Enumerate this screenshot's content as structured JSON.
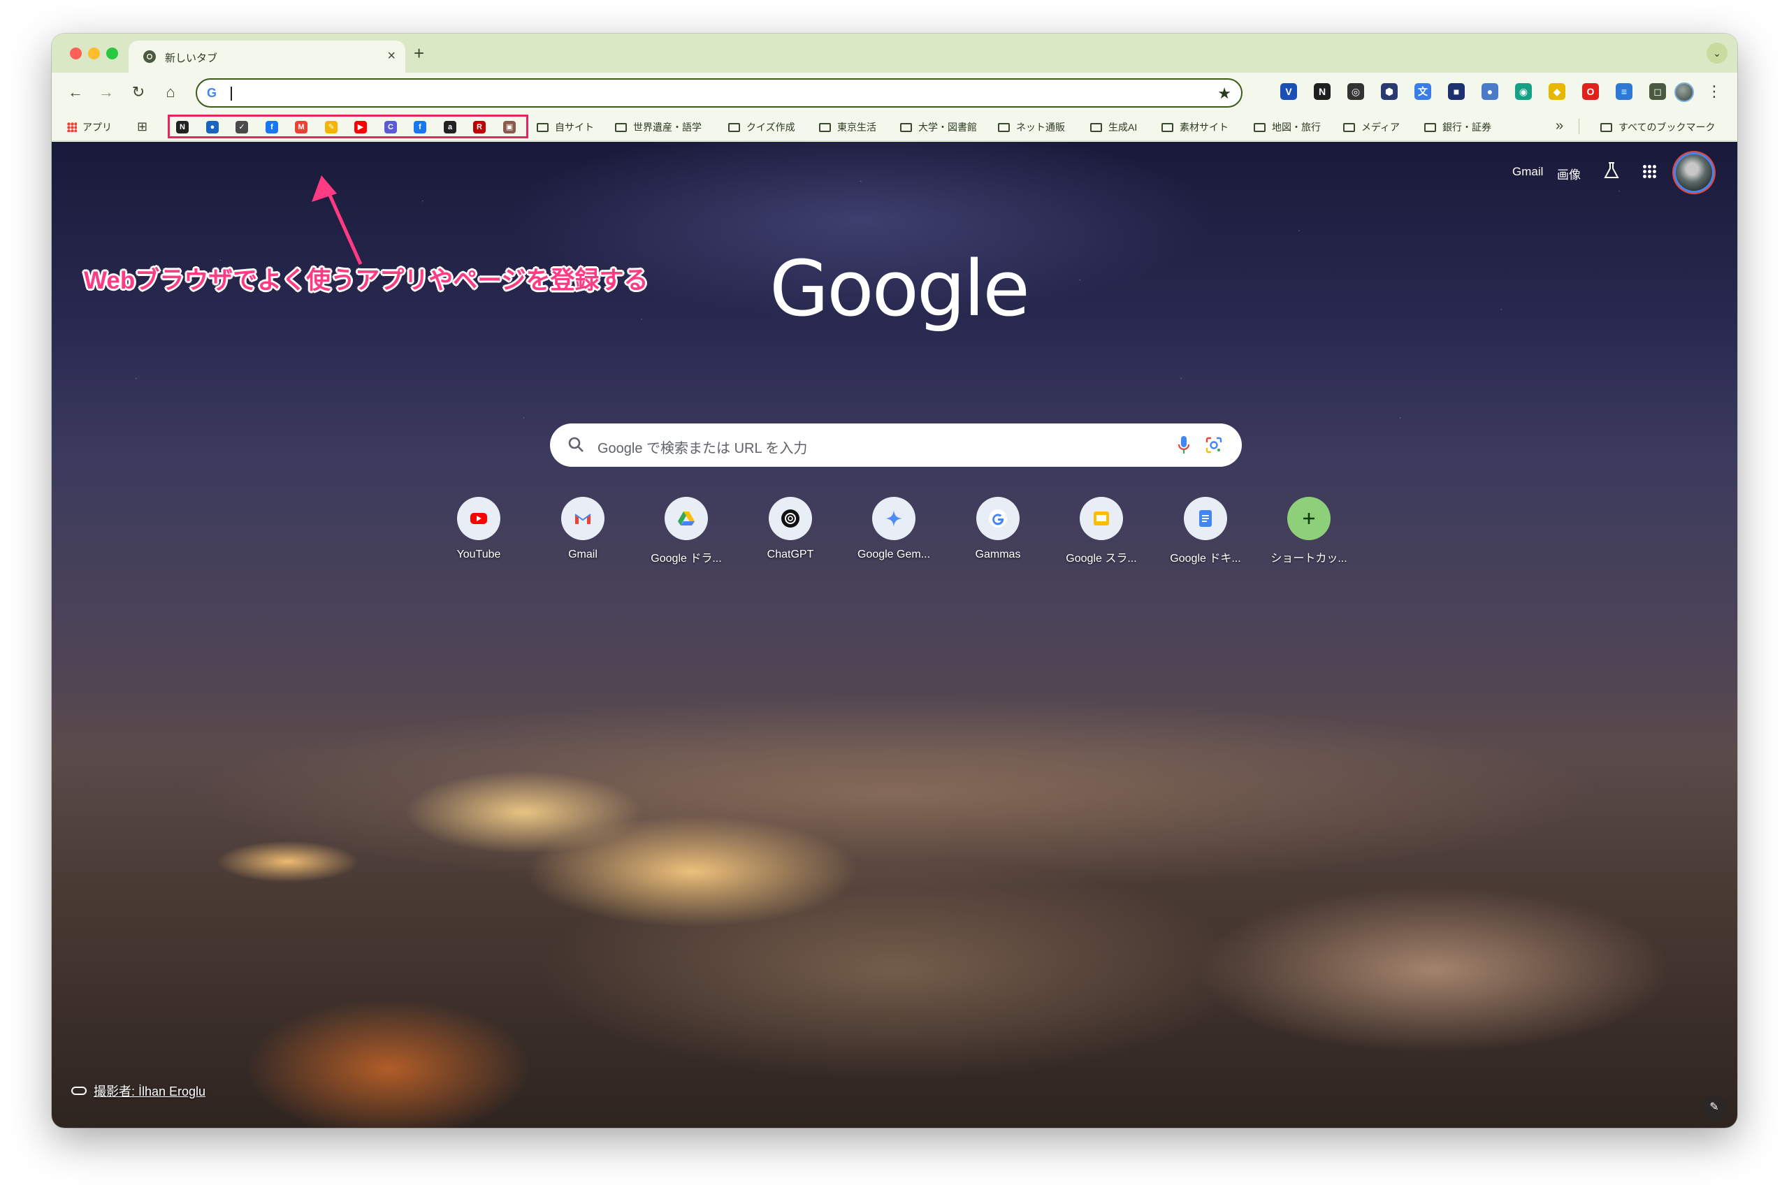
{
  "tab": {
    "title": "新しいタブ",
    "close": "×",
    "new": "+"
  },
  "toolbar": {
    "back": "←",
    "forward": "→",
    "reload": "↻",
    "home": "⌂",
    "omnibox_icon": "G",
    "bookmark_star": "★",
    "menu": "⋮"
  },
  "extensions": [
    {
      "name": "extension-v-icon",
      "glyph": "V",
      "color": "#1a4fb4"
    },
    {
      "name": "extension-notion-icon",
      "glyph": "N",
      "color": "#1f1f1f"
    },
    {
      "name": "extension-capture-icon",
      "glyph": "◎",
      "color": "#333333"
    },
    {
      "name": "extension-hex-icon",
      "glyph": "⬢",
      "color": "#2a3a6e"
    },
    {
      "name": "extension-translate-icon",
      "glyph": "文",
      "color": "#3b7de8"
    },
    {
      "name": "extension-square-icon",
      "glyph": "■",
      "color": "#1c2f6e"
    },
    {
      "name": "extension-globe-icon",
      "glyph": "●",
      "color": "#4a7ac8"
    },
    {
      "name": "extension-chat-icon",
      "glyph": "◉",
      "color": "#16a085"
    },
    {
      "name": "extension-diamond-icon",
      "glyph": "◆",
      "color": "#e6b800"
    },
    {
      "name": "extension-opera-icon",
      "glyph": "O",
      "color": "#e0201b"
    },
    {
      "name": "extension-reader-icon",
      "glyph": "≡",
      "color": "#2f78d6"
    },
    {
      "name": "extension-puzzle-icon",
      "glyph": "◻",
      "color": "#4a5a40"
    }
  ],
  "bookmarks": {
    "apps_label": "アプリ",
    "grid": "⊞",
    "favicons": [
      {
        "name": "bookmark-notion-icon",
        "glyph": "N",
        "color": "#222222"
      },
      {
        "name": "bookmark-apple-icon",
        "glyph": "●",
        "color": "#1d63c2"
      },
      {
        "name": "bookmark-check-icon",
        "glyph": "✓",
        "color": "#4a4a4a"
      },
      {
        "name": "bookmark-fb-icon",
        "glyph": "f",
        "color": "#1877f2"
      },
      {
        "name": "bookmark-gmail-icon",
        "glyph": "M",
        "color": "#ea4335"
      },
      {
        "name": "bookmark-tools-icon",
        "glyph": "✎",
        "color": "#f4b400"
      },
      {
        "name": "bookmark-youtube-icon",
        "glyph": "▶",
        "color": "#ff0000"
      },
      {
        "name": "bookmark-c-icon",
        "glyph": "C",
        "color": "#5b5bd6"
      },
      {
        "name": "bookmark-facebook-icon",
        "glyph": "f",
        "color": "#1877f2"
      },
      {
        "name": "bookmark-amazon-icon",
        "glyph": "a",
        "color": "#222222"
      },
      {
        "name": "bookmark-rakuten-icon",
        "glyph": "R",
        "color": "#bf0000"
      },
      {
        "name": "bookmark-photo-icon",
        "glyph": "▣",
        "color": "#8a5a4a"
      }
    ],
    "folders": [
      "自サイト",
      "世界遺産・語学",
      "クイズ作成",
      "東京生活",
      "大学・図書館",
      "ネット通販",
      "生成AI",
      "素材サイト",
      "地図・旅行",
      "メディア",
      "銀行・証券"
    ],
    "more": "»",
    "all_bookmarks": "すべてのブックマーク"
  },
  "ntp": {
    "gmail": "Gmail",
    "images": "画像",
    "annotation": "Webブラウザでよく使うアプリやページを登録する",
    "logo": "Google",
    "search_placeholder": "Google で検索または URL を入力",
    "shortcuts": [
      {
        "label": "YouTube",
        "icon": "youtube-icon"
      },
      {
        "label": "Gmail",
        "icon": "gmail-icon"
      },
      {
        "label": "Google ドラ...",
        "icon": "google-drive-icon"
      },
      {
        "label": "ChatGPT",
        "icon": "chatgpt-icon"
      },
      {
        "label": "Google Gem...",
        "icon": "gemini-icon"
      },
      {
        "label": "Gammas",
        "icon": "google-g-icon"
      },
      {
        "label": "Google スラ...",
        "icon": "google-slides-icon"
      },
      {
        "label": "Google ドキ...",
        "icon": "google-docs-icon"
      },
      {
        "label": "ショートカッ...",
        "icon": "add-shortcut-icon"
      }
    ],
    "photo_credit": "撮影者: İlhan Eroglu",
    "customize": "✎"
  },
  "colors": {
    "chrome_theme": "#dbe8c6",
    "toolbar": "#f3f7ec",
    "annotation": "#ff3b84",
    "highlight": "#e8245e"
  }
}
